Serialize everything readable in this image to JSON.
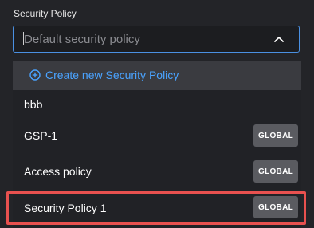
{
  "field": {
    "label": "Security Policy",
    "placeholder": "Default security policy"
  },
  "dropdown": {
    "create_label": "Create new Security Policy",
    "options": [
      {
        "label": "bbb",
        "badge": ""
      },
      {
        "label": "GSP-1",
        "badge": "GLOBAL"
      },
      {
        "label": "Access policy",
        "badge": "GLOBAL"
      },
      {
        "label": "Security Policy 1",
        "badge": "GLOBAL",
        "highlighted": true
      }
    ]
  },
  "icons": {
    "chevron": "chevron-up-icon",
    "create": "plus-circle-icon"
  },
  "colors": {
    "accent_border": "#4a90e2",
    "link": "#4aa3ff",
    "highlight": "#e8514f",
    "badge_bg": "#5a5b60"
  }
}
